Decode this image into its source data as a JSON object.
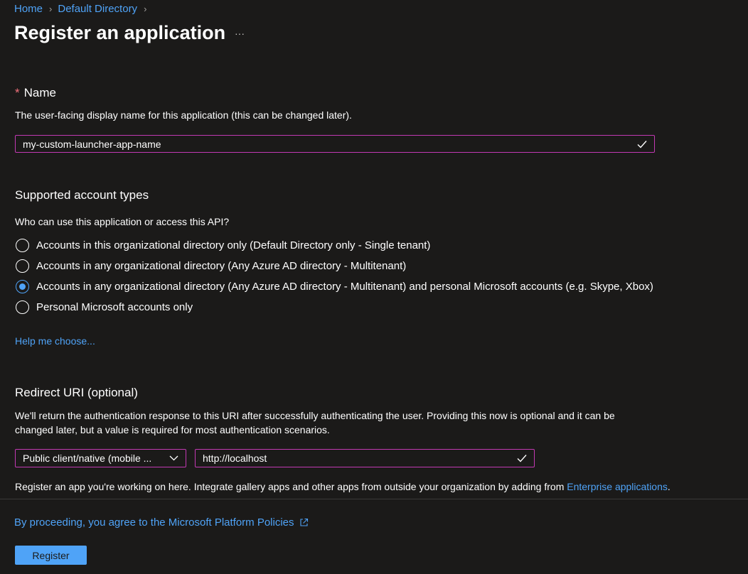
{
  "breadcrumb": {
    "items": [
      "Home",
      "Default Directory"
    ],
    "separator": "›"
  },
  "page": {
    "title": "Register an application",
    "more_menu": "···"
  },
  "name_section": {
    "required_marker": "*",
    "heading": "Name",
    "description": "The user-facing display name for this application (this can be changed later).",
    "input_value": "my-custom-launcher-app-name"
  },
  "account_types": {
    "heading": "Supported account types",
    "question": "Who can use this application or access this API?",
    "options": [
      {
        "label": "Accounts in this organizational directory only (Default Directory only - Single tenant)",
        "checked": false
      },
      {
        "label": "Accounts in any organizational directory (Any Azure AD directory - Multitenant)",
        "checked": false
      },
      {
        "label": "Accounts in any organizational directory (Any Azure AD directory - Multitenant) and personal Microsoft accounts (e.g. Skype, Xbox)",
        "checked": true
      },
      {
        "label": "Personal Microsoft accounts only",
        "checked": false
      }
    ],
    "help_link": "Help me choose..."
  },
  "redirect_uri": {
    "heading": "Redirect URI (optional)",
    "description_line1": "We'll return the authentication response to this URI after successfully authenticating the user. Providing this now is optional and it can be",
    "description_line2": "changed later, but a value is required for most authentication scenarios.",
    "platform_selected": "Public client/native (mobile ...",
    "uri_value": "http://localhost",
    "note_prefix": "Register an app you're working on here. Integrate gallery apps and other apps from outside your organization by adding from ",
    "note_link": "Enterprise applications",
    "note_suffix": "."
  },
  "footer": {
    "policy_text": "By proceeding, you agree to the Microsoft Platform Policies",
    "register_label": "Register"
  },
  "colors": {
    "background": "#1b1a19",
    "accent": "#4fa3f7",
    "input_border": "#c239b3",
    "required": "#f1707b"
  },
  "icons": {
    "crumb_separator": "chevron-right-icon",
    "input_valid": "checkmark-icon",
    "dropdown": "chevron-down-icon",
    "external": "external-link-icon"
  }
}
